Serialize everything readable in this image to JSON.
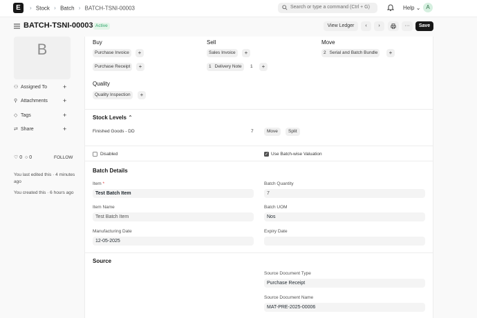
{
  "navbar": {
    "logo_letter": "E",
    "breadcrumbs": [
      "Stock",
      "Batch",
      "BATCH-TSNI-00003"
    ],
    "search_placeholder": "Search or type a command (Ctrl + G)",
    "help_label": "Help",
    "avatar_letter": "A"
  },
  "header": {
    "title": "BATCH-TSNI-00003",
    "status": "Active",
    "view_ledger_label": "View Ledger",
    "save_label": "Save"
  },
  "sidebar": {
    "image_letter": "B",
    "items": [
      {
        "label": "Assigned To",
        "icon": "user-icon"
      },
      {
        "label": "Attachments",
        "icon": "paperclip-icon"
      },
      {
        "label": "Tags",
        "icon": "tag-icon"
      },
      {
        "label": "Share",
        "icon": "share-icon"
      }
    ],
    "likes": "0",
    "comments": "0",
    "follow_label": "FOLLOW",
    "last_edited": "You last edited this · 4 minutes ago",
    "created": "You created this · 6 hours ago"
  },
  "connections": {
    "buy": {
      "heading": "Buy",
      "items": [
        {
          "label": "Purchase Invoice",
          "count": ""
        },
        {
          "label": "Purchase Receipt",
          "count": ""
        }
      ]
    },
    "sell": {
      "heading": "Sell",
      "items": [
        {
          "label": "Sales Invoice",
          "count": ""
        },
        {
          "label": "Delivery Note",
          "count": "1"
        }
      ],
      "delivery_note_badge": "1"
    },
    "move": {
      "heading": "Move",
      "items": [
        {
          "label": "Serial and Batch Bundle",
          "count": "2"
        }
      ]
    },
    "quality": {
      "heading": "Quality",
      "items": [
        {
          "label": "Quality Inspection",
          "count": ""
        }
      ]
    }
  },
  "stock_levels": {
    "title": "Stock Levels",
    "rows": [
      {
        "warehouse": "Finished Goods - DD",
        "qty": "7"
      }
    ],
    "move_label": "Move",
    "split_label": "Split"
  },
  "flags": {
    "disabled": {
      "label": "Disabled",
      "checked": false
    },
    "batchwise_valuation": {
      "label": "Use Batch-wise Valuation",
      "checked": true
    }
  },
  "batch_details": {
    "title": "Batch Details",
    "item_label": "Item",
    "item_value": "Test Batch Item",
    "batch_qty_label": "Batch Quantity",
    "batch_qty_value": "7",
    "item_name_label": "Item Name",
    "item_name_value": "Test Batch Item",
    "batch_uom_label": "Batch UOM",
    "batch_uom_value": "Nos",
    "mfg_date_label": "Manufacturing Date",
    "mfg_date_value": "12-05-2025",
    "expiry_label": "Expiry Date",
    "expiry_value": ""
  },
  "source": {
    "title": "Source",
    "doc_type_label": "Source Document Type",
    "doc_type_value": "Purchase Receipt",
    "doc_name_label": "Source Document Name",
    "doc_name_value": "MAT-PRE-2025-00006"
  },
  "colors": {
    "accent": "#171717",
    "status_bg": "#e4f5e9",
    "status_text": "#30a66d"
  }
}
